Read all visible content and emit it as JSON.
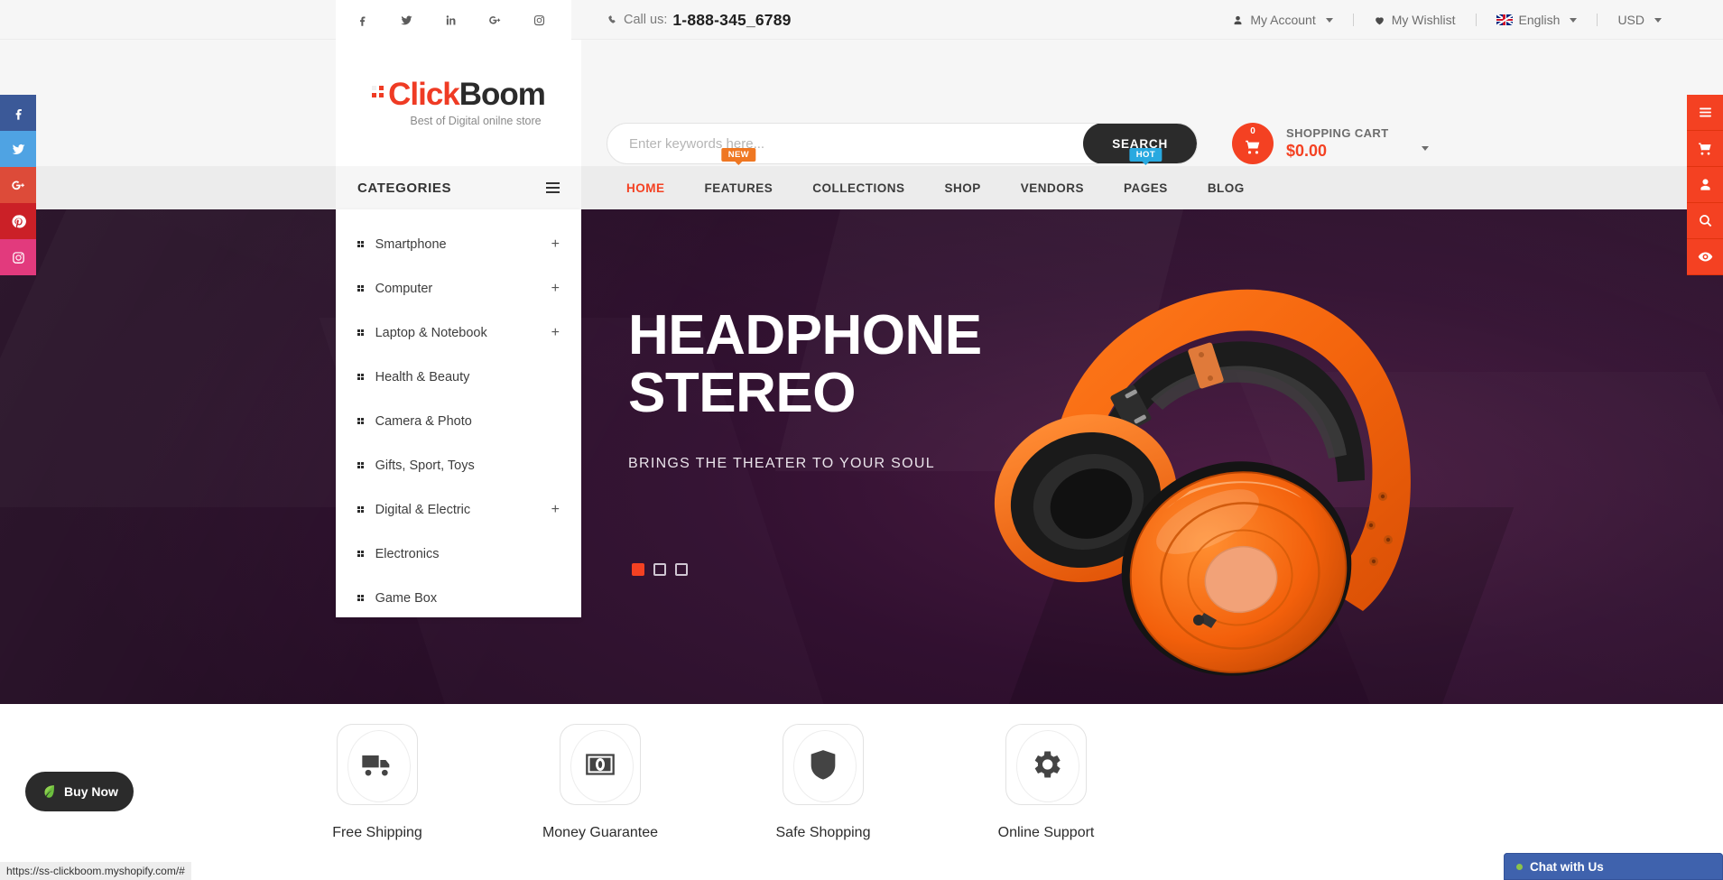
{
  "topbar": {
    "social": [
      {
        "name": "facebook-icon",
        "label": "Facebook"
      },
      {
        "name": "twitter-icon",
        "label": "Twitter"
      },
      {
        "name": "linkedin-icon",
        "label": "LinkedIn"
      },
      {
        "name": "google-plus-icon",
        "label": "Google Plus"
      },
      {
        "name": "instagram-icon",
        "label": "Instagram"
      }
    ],
    "call_label": "Call us:",
    "phone": "1-888-345_6789",
    "account": "My Account",
    "wishlist": "My Wishlist",
    "language": "English",
    "currency": "USD"
  },
  "header": {
    "logo_part1": "Click",
    "logo_part2": "Boom",
    "tagline": "Best of Digital onilne store",
    "search_placeholder": "Enter keywords here...",
    "search_value": "",
    "search_button": "SEARCH",
    "cart_count": "0",
    "cart_label": "SHOPPING CART",
    "cart_price": "$0.00"
  },
  "nav": {
    "categories_label": "CATEGORIES",
    "items": [
      {
        "label": "HOME",
        "badge": null,
        "active": true
      },
      {
        "label": "FEATURES",
        "badge": "NEW",
        "badge_type": "new",
        "active": false
      },
      {
        "label": "COLLECTIONS",
        "badge": null,
        "active": false
      },
      {
        "label": "SHOP",
        "badge": null,
        "active": false
      },
      {
        "label": "VENDORS",
        "badge": null,
        "active": false
      },
      {
        "label": "PAGES",
        "badge": "HOT",
        "badge_type": "hot",
        "active": false
      },
      {
        "label": "BLOG",
        "badge": null,
        "active": false
      }
    ]
  },
  "categories": [
    {
      "label": "Smartphone",
      "expandable": "+"
    },
    {
      "label": "Computer",
      "expandable": "+"
    },
    {
      "label": "Laptop & Notebook",
      "expandable": "+"
    },
    {
      "label": "Health & Beauty",
      "expandable": ""
    },
    {
      "label": "Camera & Photo",
      "expandable": ""
    },
    {
      "label": "Gifts, Sport, Toys",
      "expandable": ""
    },
    {
      "label": "Digital & Electric",
      "expandable": "+"
    },
    {
      "label": "Electronics",
      "expandable": ""
    },
    {
      "label": "Game Box",
      "expandable": ""
    }
  ],
  "hero": {
    "title_line1": "HEADPHONE",
    "title_line2": "STEREO",
    "subtitle": "BRINGS THE THEATER TO YOUR SOUL",
    "slides": [
      {
        "active": true
      },
      {
        "active": false
      },
      {
        "active": false
      }
    ]
  },
  "features": [
    {
      "icon": "truck-icon",
      "label": "Free Shipping"
    },
    {
      "icon": "money-icon",
      "label": "Money Guarantee"
    },
    {
      "icon": "shield-icon",
      "label": "Safe Shopping"
    },
    {
      "icon": "gear-icon",
      "label": "Online Support"
    }
  ],
  "right_rail": [
    {
      "icon": "menu-icon"
    },
    {
      "icon": "cart-icon"
    },
    {
      "icon": "user-icon"
    },
    {
      "icon": "search-icon"
    },
    {
      "icon": "eye-icon"
    }
  ],
  "buy_now": {
    "label": "Buy Now"
  },
  "chat": {
    "label": "Chat with Us"
  },
  "statusbar": {
    "url": "https://ss-clickboom.myshopify.com/#"
  },
  "colors": {
    "brand_red": "#ef3b24",
    "accent_orange": "#f44122",
    "badge_new": "#ef7722",
    "badge_hot": "#28a9e0",
    "dark": "#2b2b2b",
    "hero_bg": "#2a0d28"
  }
}
